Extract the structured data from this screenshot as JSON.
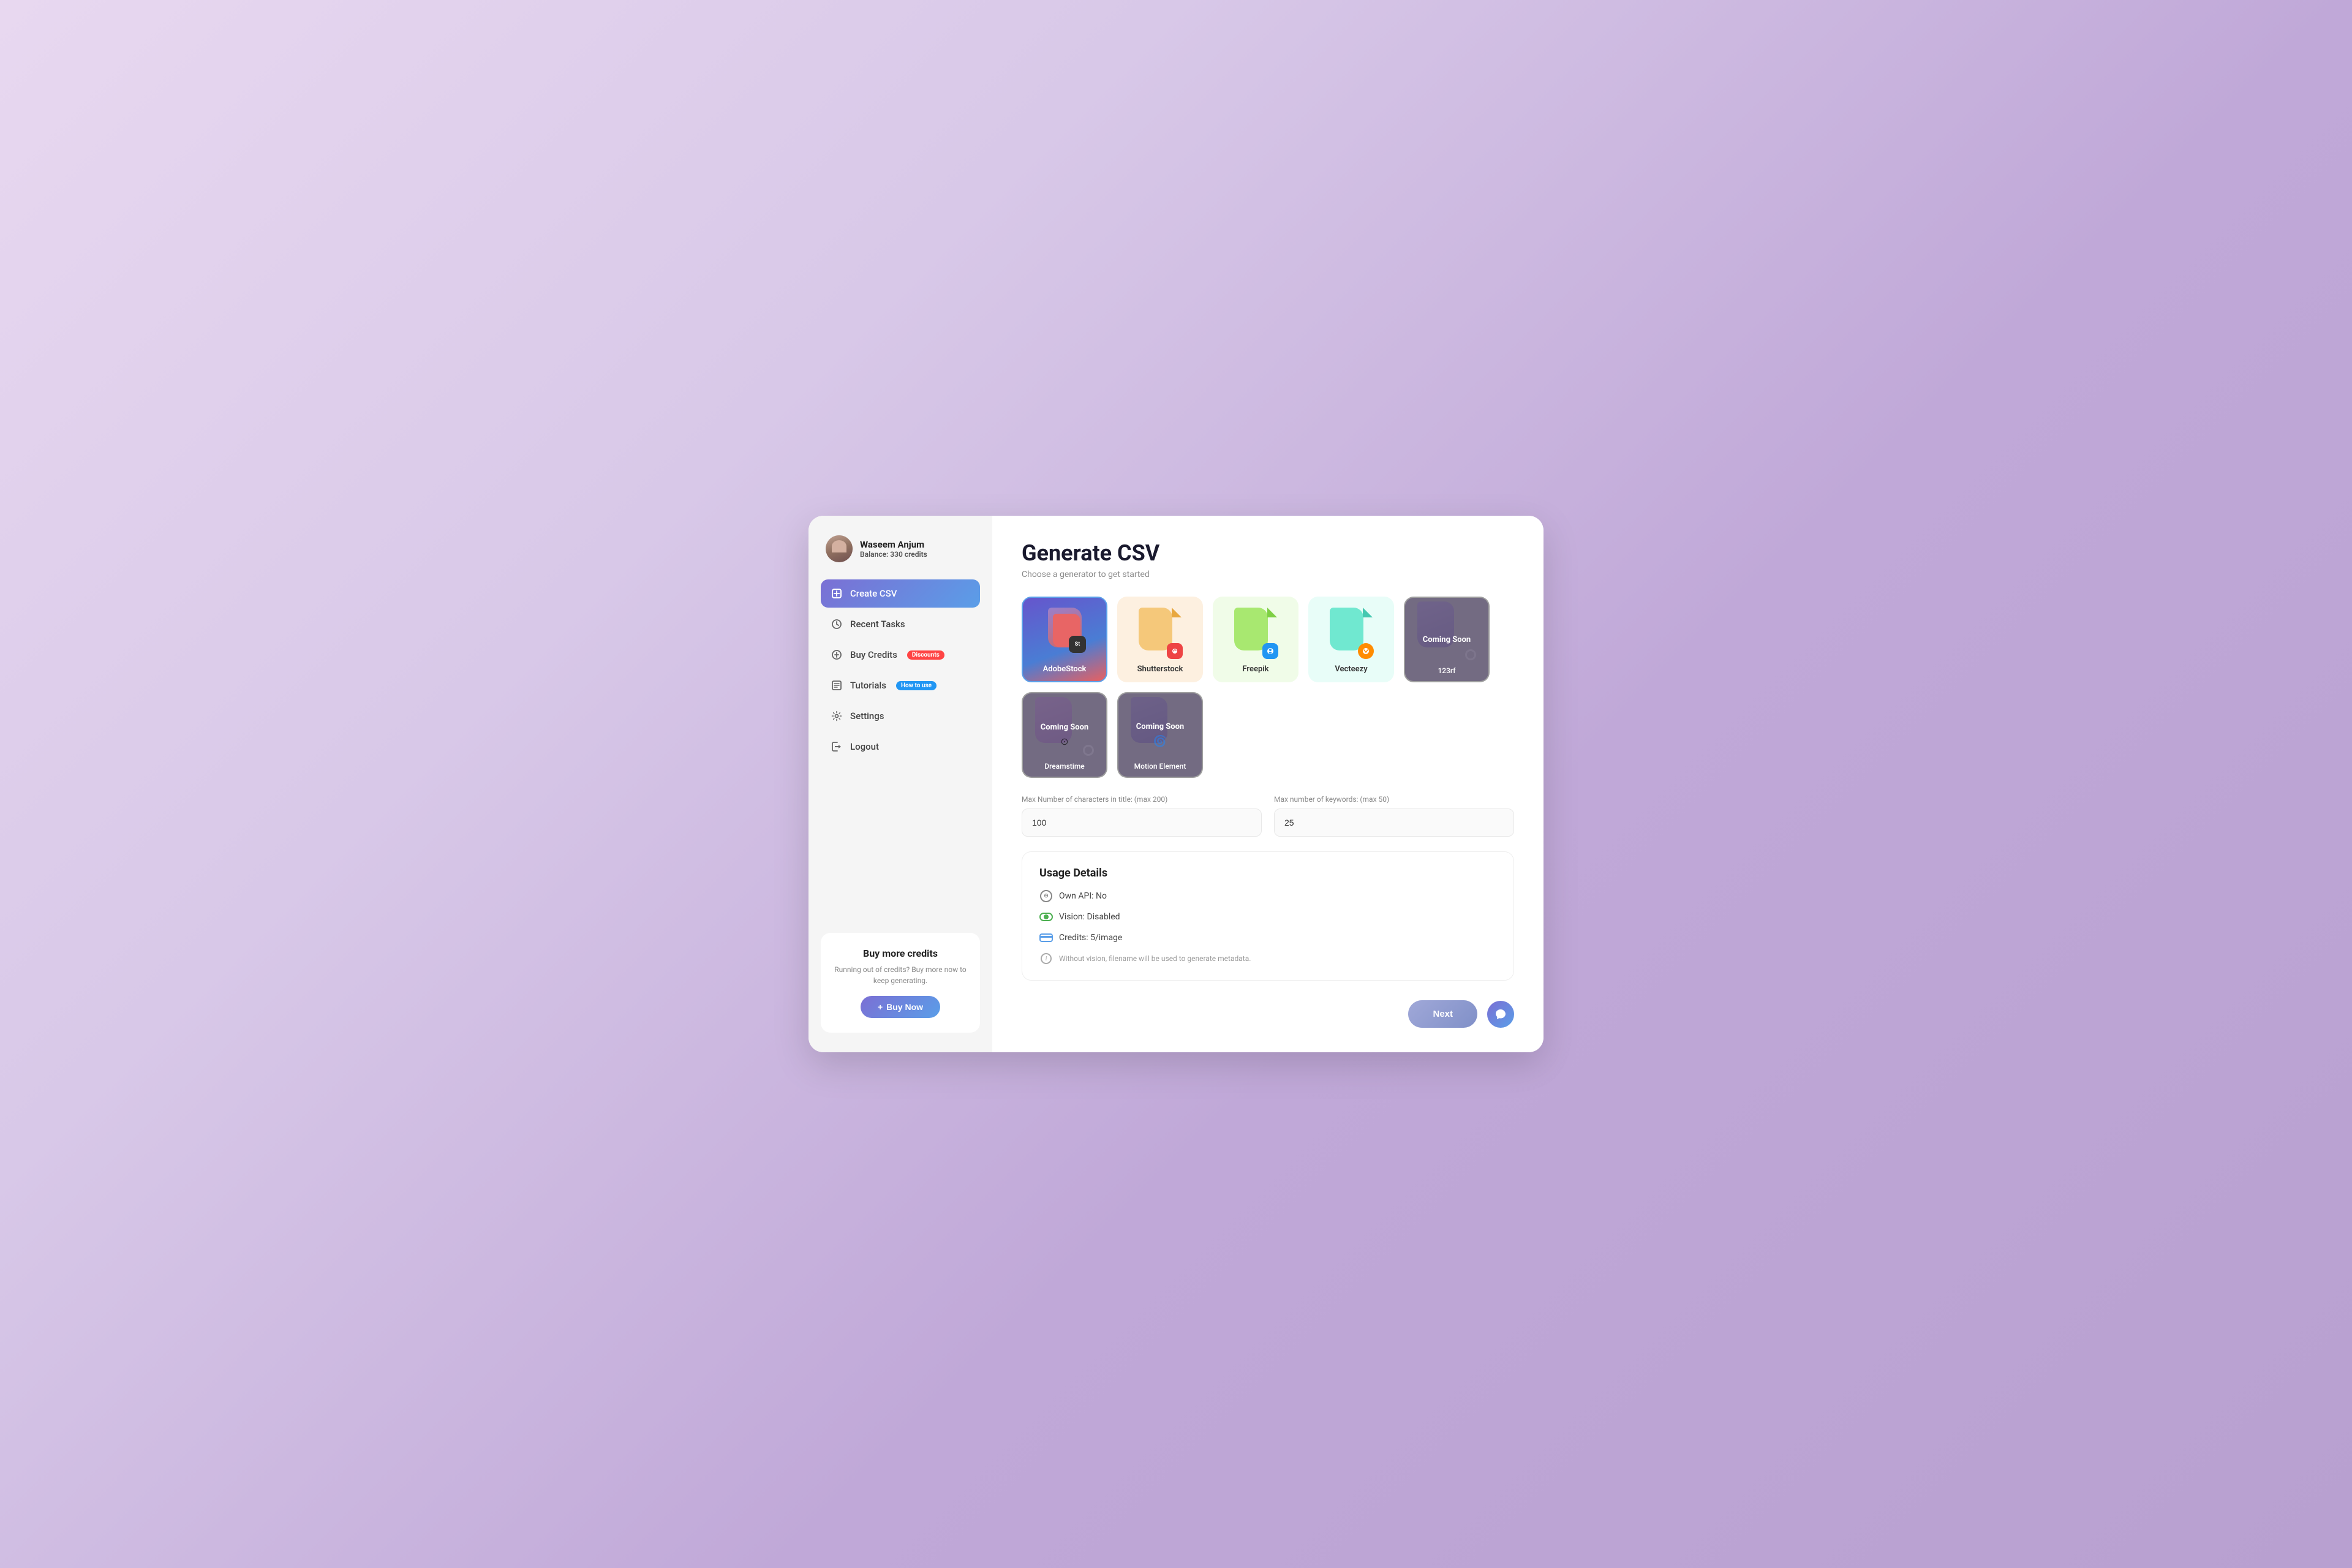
{
  "user": {
    "name": "Waseem Anjum",
    "balance_label": "Balance:",
    "balance_value": "330 credits"
  },
  "sidebar": {
    "nav_items": [
      {
        "id": "create-csv",
        "label": "Create CSV",
        "active": true,
        "badge": null
      },
      {
        "id": "recent-tasks",
        "label": "Recent Tasks",
        "active": false,
        "badge": null
      },
      {
        "id": "buy-credits",
        "label": "Buy Credits",
        "active": false,
        "badge": "Discounts"
      },
      {
        "id": "tutorials",
        "label": "Tutorials",
        "active": false,
        "badge": "How to use"
      },
      {
        "id": "settings",
        "label": "Settings",
        "active": false,
        "badge": null
      },
      {
        "id": "logout",
        "label": "Logout",
        "active": false,
        "badge": null
      }
    ],
    "buy_card": {
      "title": "Buy more credits",
      "description": "Running out of credits? Buy more now to keep generating.",
      "button_label": "Buy Now"
    }
  },
  "main": {
    "title": "Generate CSV",
    "subtitle": "Choose a generator to get started",
    "generators": [
      {
        "id": "adobestock",
        "name": "AdobeStock",
        "coming_soon": false,
        "selected": true
      },
      {
        "id": "shutterstock",
        "name": "Shutterstock",
        "coming_soon": false,
        "selected": false
      },
      {
        "id": "freepik",
        "name": "Freepik",
        "coming_soon": false,
        "selected": false
      },
      {
        "id": "vecteezy",
        "name": "Vecteezy",
        "coming_soon": false,
        "selected": false
      },
      {
        "id": "123rf",
        "name": "123rf",
        "coming_soon": true,
        "selected": false
      },
      {
        "id": "dreamstime",
        "name": "Dreamstime",
        "coming_soon": true,
        "selected": false
      },
      {
        "id": "motion-element",
        "name": "Motion Element",
        "coming_soon": true,
        "selected": false
      }
    ],
    "form": {
      "title_label": "Max Number of characters in title: (max 200)",
      "title_value": "100",
      "keywords_label": "Max number of keywords: (max 50)",
      "keywords_value": "25"
    },
    "usage": {
      "section_title": "Usage Details",
      "items": [
        {
          "id": "own-api",
          "label": "Own API: No"
        },
        {
          "id": "vision",
          "label": "Vision: Disabled"
        },
        {
          "id": "credits",
          "label": "Credits: 5/image"
        }
      ],
      "note": "Without vision, filename will be used to generate metadata."
    },
    "next_button": "Next"
  },
  "colors": {
    "primary_gradient_start": "#7b6fd4",
    "primary_gradient_end": "#5a9ee8",
    "accent_red": "#f44444",
    "accent_blue": "#2196F3",
    "badge_discount_bg": "#f44444",
    "badge_howto_bg": "#2196F3"
  }
}
